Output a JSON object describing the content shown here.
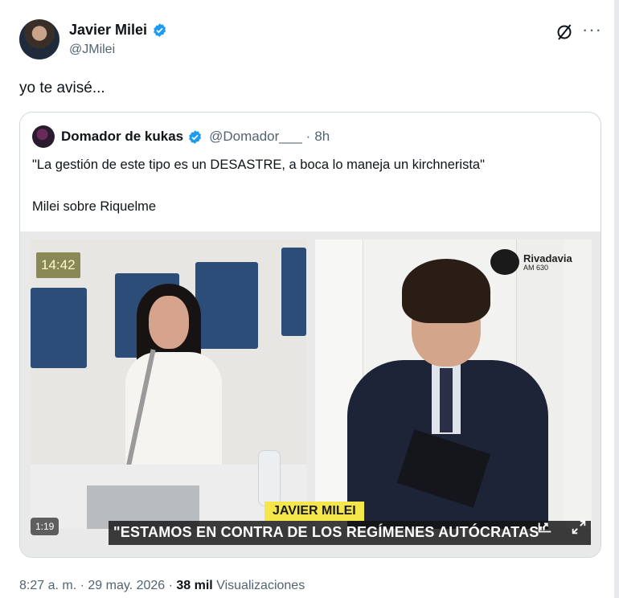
{
  "author": {
    "name": "Javier Milei",
    "handle": "@JMilei"
  },
  "tweet": {
    "text": "yo te avisé..."
  },
  "quoted": {
    "name": "Domador de kukas",
    "handle": "@Domador___",
    "separator": "·",
    "time": "8h",
    "text_line1": "\"La gestión de este tipo es un DESASTRE, a boca lo maneja un kirchnerista\"",
    "text_line2": "Milei sobre Riquelme"
  },
  "video": {
    "clock_badge": "14:42",
    "station_name": "Rivadavia",
    "station_freq": "AM 630",
    "name_tag": "JAVIER MILEI",
    "caption": "\"ESTAMOS EN CONTRA DE LOS REGÍMENES AUTÓCRATAS\"",
    "duration": "1:19"
  },
  "footer": {
    "time": "8:27 a. m.",
    "dot": "·",
    "date": "29 may. 2026",
    "dot2": "·",
    "views_count": "38 mil",
    "views_label": "Visualizaciones"
  },
  "colors": {
    "verified": "#1d9bf0",
    "secondary_text": "#536471",
    "name_tag": "#f5e64a"
  },
  "icons": {
    "verified": "verified-badge-icon",
    "grok": "grok-slash-icon",
    "more": "more-dots-icon"
  }
}
